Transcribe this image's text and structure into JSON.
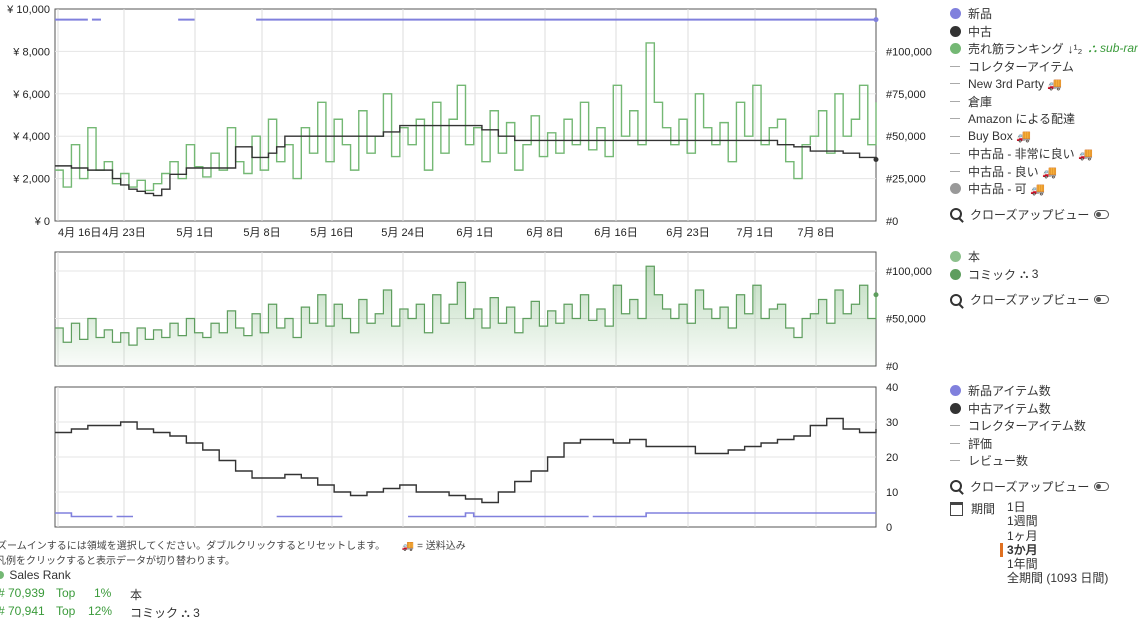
{
  "chart_data": [
    {
      "type": "line",
      "name": "price-and-rank",
      "x_tick_labels": [
        "4月 16日",
        "4月 23日",
        "5月 1日",
        "5月 8日",
        "5月 16日",
        "5月 24日",
        "6月 1日",
        "6月 8日",
        "6月 16日",
        "6月 23日",
        "7月 1日",
        "7月 8日"
      ],
      "y_left_ticks": [
        "¥ 0",
        "¥ 2,000",
        "¥ 4,000",
        "¥ 6,000",
        "¥ 8,000",
        "¥ 10,000"
      ],
      "y_left_range": [
        0,
        10000
      ],
      "y_right_ticks": [
        "#0",
        "#25,000",
        "#50,000",
        "#75,000",
        "#100,000"
      ],
      "y_right_range": [
        0,
        125000
      ],
      "grid": true,
      "series": [
        {
          "name": "新品",
          "color": "#8080dd",
          "axis": "left",
          "segments": [
            [
              [
                0,
                9500
              ],
              [
                4,
                9500
              ]
            ],
            [
              [
                4.5,
                9500
              ],
              [
                5.6,
                9500
              ]
            ],
            [
              [
                15,
                9500
              ],
              [
                17,
                9500
              ]
            ],
            [
              [
                24.5,
                9500
              ],
              [
                100,
                9500
              ]
            ]
          ]
        },
        {
          "name": "中古",
          "color": "#333333",
          "axis": "left",
          "x": [
            0,
            2,
            4,
            6,
            7,
            8,
            9,
            10,
            11,
            12,
            13,
            14,
            16,
            18,
            20,
            22,
            24,
            26,
            27,
            28,
            30,
            32,
            34,
            36,
            38,
            40,
            42,
            44,
            46,
            48,
            50,
            52,
            54,
            56,
            58,
            60,
            62,
            64,
            66,
            68,
            70,
            72,
            74,
            76,
            78,
            80,
            82,
            84,
            86,
            88,
            90,
            92,
            94,
            96,
            98,
            100
          ],
          "y": [
            2600,
            2500,
            2400,
            2400,
            2000,
            1700,
            1500,
            1400,
            1300,
            1200,
            1500,
            2200,
            2500,
            2500,
            2500,
            3500,
            3000,
            3200,
            3500,
            4000,
            4000,
            4000,
            4000,
            4000,
            4000,
            4200,
            4500,
            4500,
            4500,
            4500,
            4500,
            4300,
            4000,
            3800,
            3800,
            3800,
            3800,
            3800,
            3800,
            3800,
            3800,
            3800,
            3800,
            3800,
            3800,
            3800,
            3800,
            3800,
            3800,
            3600,
            3500,
            3300,
            3300,
            3200,
            3000,
            2900
          ]
        },
        {
          "name": "売れ筋ランキング",
          "color": "#74b874",
          "axis": "right",
          "x": [
            0,
            1,
            2,
            3,
            4,
            5,
            6,
            7,
            8,
            9,
            10,
            11,
            12,
            13,
            14,
            15,
            16,
            17,
            18,
            19,
            20,
            21,
            22,
            23,
            24,
            25,
            26,
            27,
            28,
            29,
            30,
            31,
            32,
            33,
            34,
            35,
            36,
            37,
            38,
            39,
            40,
            41,
            42,
            43,
            44,
            45,
            46,
            47,
            48,
            49,
            50,
            51,
            52,
            53,
            54,
            55,
            56,
            57,
            58,
            59,
            60,
            61,
            62,
            63,
            64,
            65,
            66,
            67,
            68,
            69,
            70,
            71,
            72,
            73,
            74,
            75,
            76,
            77,
            78,
            79,
            80,
            81,
            82,
            83,
            84,
            85,
            86,
            87,
            88,
            89,
            90,
            91,
            92,
            93,
            94,
            95,
            96,
            97,
            98,
            99,
            100
          ],
          "y": [
            30000,
            20000,
            45000,
            25000,
            55000,
            30000,
            35000,
            22000,
            28000,
            20000,
            24000,
            18000,
            22000,
            28000,
            35000,
            25000,
            45000,
            32000,
            26000,
            40000,
            30000,
            55000,
            35000,
            28000,
            50000,
            30000,
            60000,
            35000,
            45000,
            25000,
            55000,
            40000,
            70000,
            35000,
            60000,
            45000,
            30000,
            65000,
            40000,
            50000,
            75000,
            38000,
            55000,
            45000,
            60000,
            30000,
            70000,
            40000,
            60000,
            80000,
            45000,
            55000,
            35000,
            65000,
            40000,
            58000,
            30000,
            45000,
            62000,
            38000,
            52000,
            40000,
            60000,
            45000,
            70000,
            42000,
            55000,
            38000,
            80000,
            50000,
            65000,
            45000,
            105000,
            70000,
            55000,
            45000,
            60000,
            40000,
            75000,
            55000,
            45000,
            58000,
            35000,
            70000,
            50000,
            80000,
            45000,
            55000,
            60000,
            35000,
            25000,
            45000,
            50000,
            65000,
            40000,
            75000,
            50000,
            60000,
            80000,
            45000,
            70000
          ]
        }
      ]
    },
    {
      "type": "area",
      "name": "category-rank",
      "y_right_ticks": [
        "#0",
        "#50,000",
        "#100,000"
      ],
      "y_right_range": [
        0,
        120000
      ],
      "grid": true,
      "series": [
        {
          "name": "本",
          "color": "#74b874"
        },
        {
          "name": "コミック",
          "color": "#5e9e5e",
          "x": [
            0,
            1,
            2,
            3,
            4,
            5,
            6,
            7,
            8,
            9,
            10,
            11,
            12,
            13,
            14,
            15,
            16,
            17,
            18,
            19,
            20,
            21,
            22,
            23,
            24,
            25,
            26,
            27,
            28,
            29,
            30,
            31,
            32,
            33,
            34,
            35,
            36,
            37,
            38,
            39,
            40,
            41,
            42,
            43,
            44,
            45,
            46,
            47,
            48,
            49,
            50,
            51,
            52,
            53,
            54,
            55,
            56,
            57,
            58,
            59,
            60,
            61,
            62,
            63,
            64,
            65,
            66,
            67,
            68,
            69,
            70,
            71,
            72,
            73,
            74,
            75,
            76,
            77,
            78,
            79,
            80,
            81,
            82,
            83,
            84,
            85,
            86,
            87,
            88,
            89,
            90,
            91,
            92,
            93,
            94,
            95,
            96,
            97,
            98,
            99,
            100
          ],
          "y": [
            40000,
            25000,
            45000,
            28000,
            50000,
            30000,
            38000,
            25000,
            35000,
            22000,
            40000,
            28000,
            38000,
            30000,
            45000,
            32000,
            50000,
            35000,
            30000,
            45000,
            35000,
            58000,
            40000,
            32000,
            55000,
            35000,
            65000,
            40000,
            50000,
            30000,
            62000,
            45000,
            75000,
            42000,
            65000,
            50000,
            35000,
            70000,
            45000,
            55000,
            80000,
            42000,
            60000,
            50000,
            65000,
            35000,
            75000,
            45000,
            65000,
            88000,
            50000,
            60000,
            40000,
            72000,
            45000,
            62000,
            35000,
            50000,
            68000,
            42000,
            58000,
            45000,
            65000,
            50000,
            75000,
            48000,
            60000,
            42000,
            85000,
            55000,
            70000,
            50000,
            105000,
            75000,
            60000,
            50000,
            65000,
            45000,
            80000,
            60000,
            50000,
            62000,
            40000,
            75000,
            55000,
            85000,
            50000,
            60000,
            65000,
            40000,
            30000,
            50000,
            55000,
            70000,
            45000,
            80000,
            55000,
            65000,
            85000,
            50000,
            75000
          ]
        }
      ]
    },
    {
      "type": "line",
      "name": "offer-count",
      "y_right_ticks": [
        "0",
        "10",
        "20",
        "30",
        "40"
      ],
      "y_right_range": [
        0,
        40
      ],
      "grid": true,
      "series": [
        {
          "name": "新品アイテム数",
          "color": "#8080dd",
          "segments": [
            [
              [
                0,
                4
              ],
              [
                2,
                4
              ],
              [
                2,
                3
              ],
              [
                7,
                3
              ]
            ],
            [
              [
                7.5,
                3
              ],
              [
                9.5,
                3
              ]
            ],
            [
              [
                27,
                3
              ],
              [
                35,
                3
              ]
            ],
            [
              [
                43,
                3
              ],
              [
                50,
                3
              ],
              [
                50,
                4
              ],
              [
                51,
                4
              ],
              [
                51,
                3
              ],
              [
                65,
                3
              ]
            ],
            [
              [
                65.5,
                3
              ],
              [
                67,
                3
              ],
              [
                72,
                3
              ],
              [
                72,
                4
              ],
              [
                100,
                4
              ]
            ]
          ]
        },
        {
          "name": "中古アイテム数",
          "color": "#333333",
          "x": [
            0,
            2,
            4,
            6,
            8,
            10,
            12,
            14,
            16,
            18,
            20,
            22,
            24,
            26,
            28,
            30,
            32,
            34,
            36,
            38,
            40,
            42,
            44,
            46,
            48,
            50,
            52,
            54,
            56,
            58,
            60,
            62,
            64,
            66,
            68,
            70,
            72,
            74,
            76,
            78,
            80,
            82,
            84,
            86,
            88,
            90,
            92,
            94,
            96,
            98,
            100
          ],
          "y": [
            27,
            28,
            29,
            29,
            30,
            28,
            27,
            26,
            24,
            22,
            19,
            16,
            14,
            14,
            15,
            14,
            12,
            10,
            9,
            10,
            11,
            12,
            10,
            10,
            9,
            8,
            7,
            10,
            13,
            16,
            20,
            24,
            25,
            25,
            24,
            25,
            23,
            23,
            23,
            21,
            21,
            22,
            23,
            24,
            25,
            26,
            29,
            31,
            28,
            27,
            28
          ]
        }
      ]
    }
  ],
  "legend_top": {
    "items": [
      {
        "label": "新品",
        "type": "dot",
        "color": "#8080dd"
      },
      {
        "label": "中古",
        "type": "dot",
        "color": "#333333"
      },
      {
        "label": "売れ筋ランキング",
        "type": "dot",
        "color": "#74b874",
        "suffix": "↓¹₂",
        "sub": "sub-ran"
      },
      {
        "label": "コレクターアイテム",
        "type": "dash"
      },
      {
        "label": "New 3rd Party 🚚",
        "type": "dash"
      },
      {
        "label": "倉庫",
        "type": "dash"
      },
      {
        "label": "Amazon による配達",
        "type": "dash"
      },
      {
        "label": "Buy Box 🚚",
        "type": "dash"
      },
      {
        "label": "中古品 - 非常に良い 🚚",
        "type": "dash"
      },
      {
        "label": "中古品 - 良い 🚚",
        "type": "dash"
      },
      {
        "label": "中古品 - 可 🚚",
        "type": "dot",
        "color": "#999999"
      }
    ],
    "closeup": "クローズアップビュー"
  },
  "legend_mid": {
    "items": [
      {
        "label": "本",
        "type": "dot",
        "color": "#8cc08c"
      },
      {
        "label": "コミック",
        "type": "dot",
        "color": "#5e9e5e",
        "suffix": "⛬ 3"
      }
    ],
    "closeup": "クローズアップビュー"
  },
  "legend_bottom": {
    "items": [
      {
        "label": "新品アイテム数",
        "type": "dot",
        "color": "#8080dd"
      },
      {
        "label": "中古アイテム数",
        "type": "dot",
        "color": "#333333"
      },
      {
        "label": "コレクターアイテム数",
        "type": "dash"
      },
      {
        "label": "評価",
        "type": "dash"
      },
      {
        "label": "レビュー数",
        "type": "dash"
      }
    ],
    "closeup": "クローズアップビュー"
  },
  "period": {
    "label": "期間",
    "options": [
      "1日",
      "1週間",
      "1ヶ月",
      "3か月",
      "1年間",
      "全期間 (1093 日間)"
    ],
    "selected": "3か月"
  },
  "footnote": {
    "line1": "ズームインするには領域を選択してください。ダブルクリックするとリセットします。",
    "shipping": "🚚 = 送料込み",
    "line2": "凡例をクリックすると表示データが切り替わります。"
  },
  "sales_rank": {
    "title": "Sales Rank",
    "rows": [
      {
        "hash": "#",
        "rank": "70,939",
        "top": "Top",
        "pct": "1%",
        "category": "本"
      },
      {
        "hash": "#",
        "rank": "70,941",
        "top": "Top",
        "pct": "12%",
        "category": "コミック ⛬ 3"
      }
    ]
  }
}
